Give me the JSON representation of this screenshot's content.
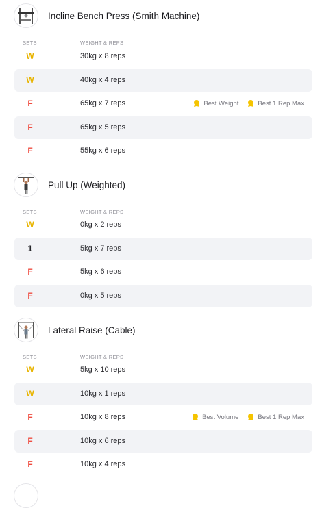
{
  "colors": {
    "warmup": "#e8b400",
    "failure": "#ef4c40",
    "normal": "#26262a",
    "row_alt": "#f2f3f6",
    "medal": "#f5c400"
  },
  "exercises": [
    {
      "title": "Incline Bench Press (Smith Machine)",
      "thumb_icon": "smith-machine-icon",
      "col_sets": "SETS",
      "col_weight": "WEIGHT & REPS",
      "sets": [
        {
          "label": "W",
          "type": "W",
          "value": "30kg x 8 reps"
        },
        {
          "label": "W",
          "type": "W",
          "value": "40kg x 4 reps"
        },
        {
          "label": "F",
          "type": "F",
          "value": "65kg x 7 reps",
          "badges": [
            "Best Weight",
            "Best 1 Rep Max"
          ]
        },
        {
          "label": "F",
          "type": "F",
          "value": "65kg x 5 reps"
        },
        {
          "label": "F",
          "type": "F",
          "value": "55kg x 6 reps"
        }
      ]
    },
    {
      "title": "Pull Up (Weighted)",
      "thumb_icon": "pull-up-icon",
      "col_sets": "SETS",
      "col_weight": "WEIGHT & REPS",
      "sets": [
        {
          "label": "W",
          "type": "W",
          "value": "0kg x 2 reps"
        },
        {
          "label": "1",
          "type": "N",
          "value": "5kg x 7 reps"
        },
        {
          "label": "F",
          "type": "F",
          "value": "5kg x 6 reps"
        },
        {
          "label": "F",
          "type": "F",
          "value": "0kg x 5 reps"
        }
      ]
    },
    {
      "title": "Lateral Raise (Cable)",
      "thumb_icon": "cable-machine-icon",
      "col_sets": "SETS",
      "col_weight": "WEIGHT & REPS",
      "sets": [
        {
          "label": "W",
          "type": "W",
          "value": "5kg x 10 reps"
        },
        {
          "label": "W",
          "type": "W",
          "value": "10kg x 1 reps"
        },
        {
          "label": "F",
          "type": "F",
          "value": "10kg x 8 reps",
          "badges": [
            "Best Volume",
            "Best 1 Rep Max"
          ]
        },
        {
          "label": "F",
          "type": "F",
          "value": "10kg x 6 reps"
        },
        {
          "label": "F",
          "type": "F",
          "value": "10kg x 4 reps"
        }
      ]
    }
  ]
}
